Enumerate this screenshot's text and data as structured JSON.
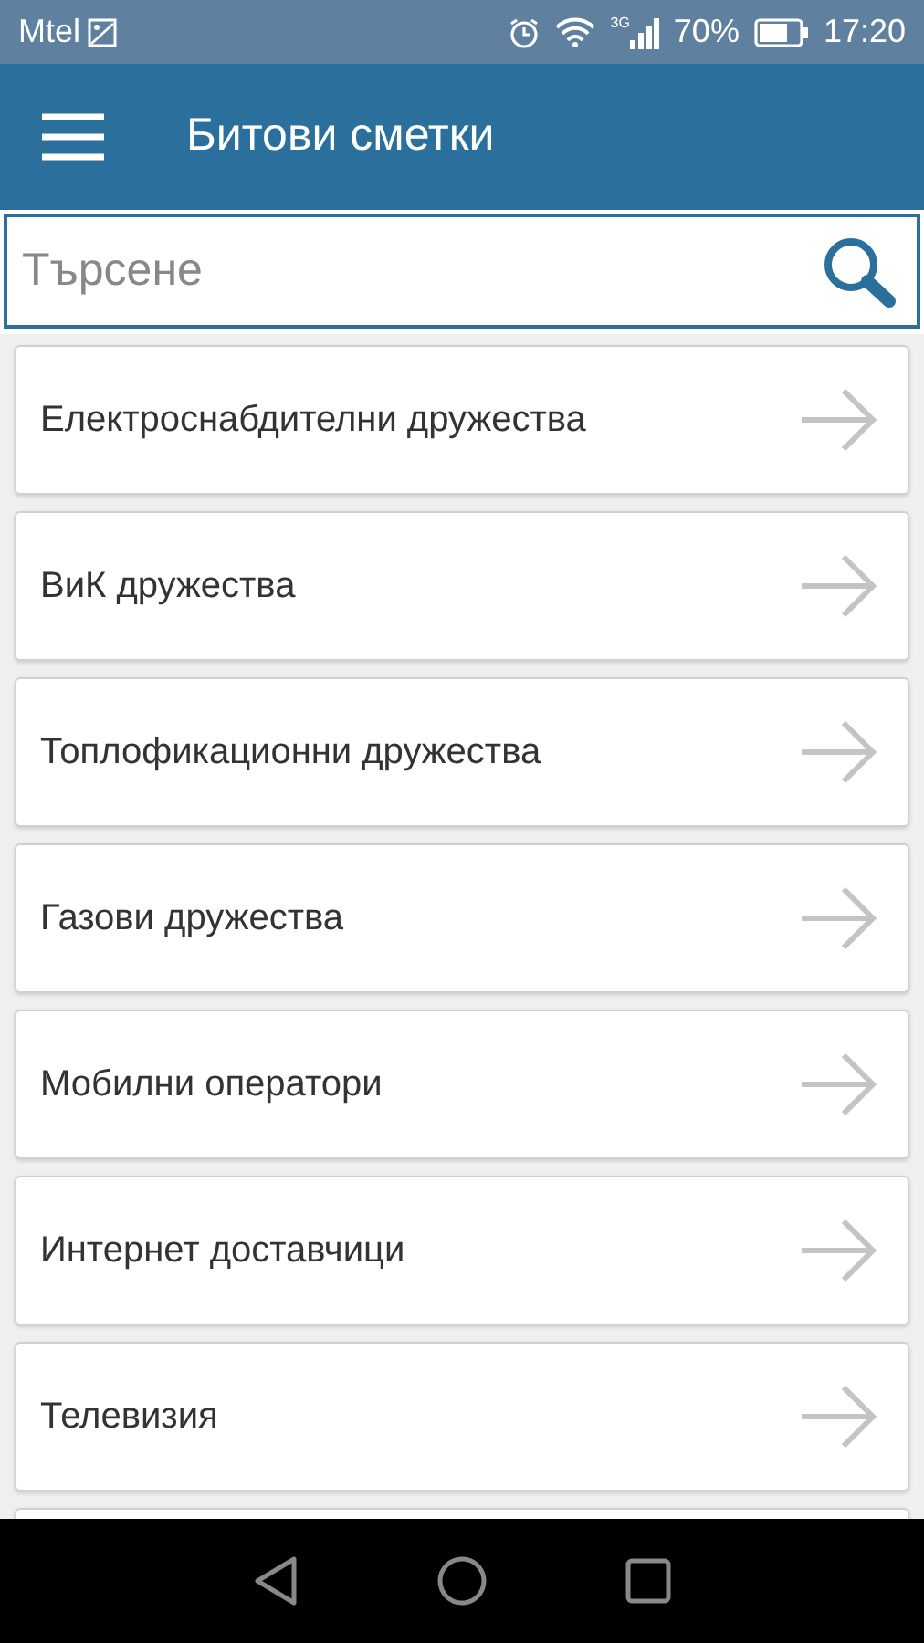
{
  "status_bar": {
    "carrier": "Mtel",
    "network": "3G",
    "battery": "70%",
    "time": "17:20"
  },
  "app_bar": {
    "title": "Битови сметки"
  },
  "search": {
    "placeholder": "Търсене"
  },
  "categories": [
    {
      "label": "Електроснабдителни дружества"
    },
    {
      "label": "ВиК дружества"
    },
    {
      "label": "Топлофикационни дружества"
    },
    {
      "label": "Газови дружества"
    },
    {
      "label": "Мобилни оператори"
    },
    {
      "label": "Интернет доставчици"
    },
    {
      "label": "Телевизия"
    }
  ]
}
